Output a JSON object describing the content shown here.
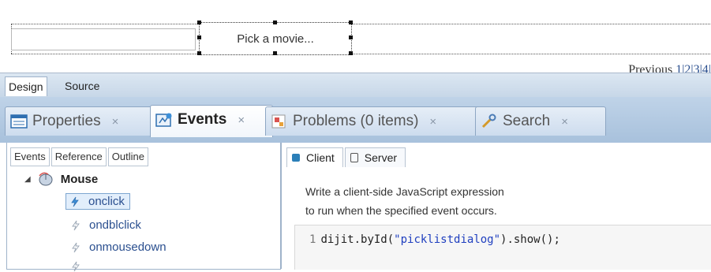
{
  "canvas": {
    "button_label": "Pick a movie...",
    "pager_text": "Previous",
    "pager_pages": "1|2|3|4|"
  },
  "view_tabs": {
    "design": "Design",
    "source": "Source"
  },
  "panel_tabs": [
    {
      "label": "Properties",
      "icon": "properties-icon",
      "close": "×"
    },
    {
      "label": "Events",
      "icon": "events-icon",
      "close": "×"
    },
    {
      "label": "Problems (0 items)",
      "icon": "problems-icon",
      "close": "×"
    },
    {
      "label": "Search",
      "icon": "search-icon",
      "close": "×"
    }
  ],
  "left_panel": {
    "sub_tabs": [
      "Events",
      "Reference",
      "Outline"
    ],
    "tree": {
      "category": "Mouse",
      "category_icon": "mouse-icon",
      "items": [
        "onclick",
        "ondblclick",
        "onmousedown"
      ],
      "selected": "onclick"
    }
  },
  "right_panel": {
    "tabs": [
      "Client",
      "Server"
    ],
    "active_tab": "Client",
    "hint_line1": "Write a client-side JavaScript expression",
    "hint_line2": "to run when the specified event occurs.",
    "code": {
      "line_number": "1",
      "before": "dijit.byId(",
      "string": "\"picklistdialog\"",
      "after": ").show();"
    }
  },
  "colors": {
    "tab_strip": "#a8c1dc",
    "link_blue": "#2a4f8f",
    "code_string": "#1f3fbf",
    "client_tab_icon": "#2b7fb8"
  }
}
